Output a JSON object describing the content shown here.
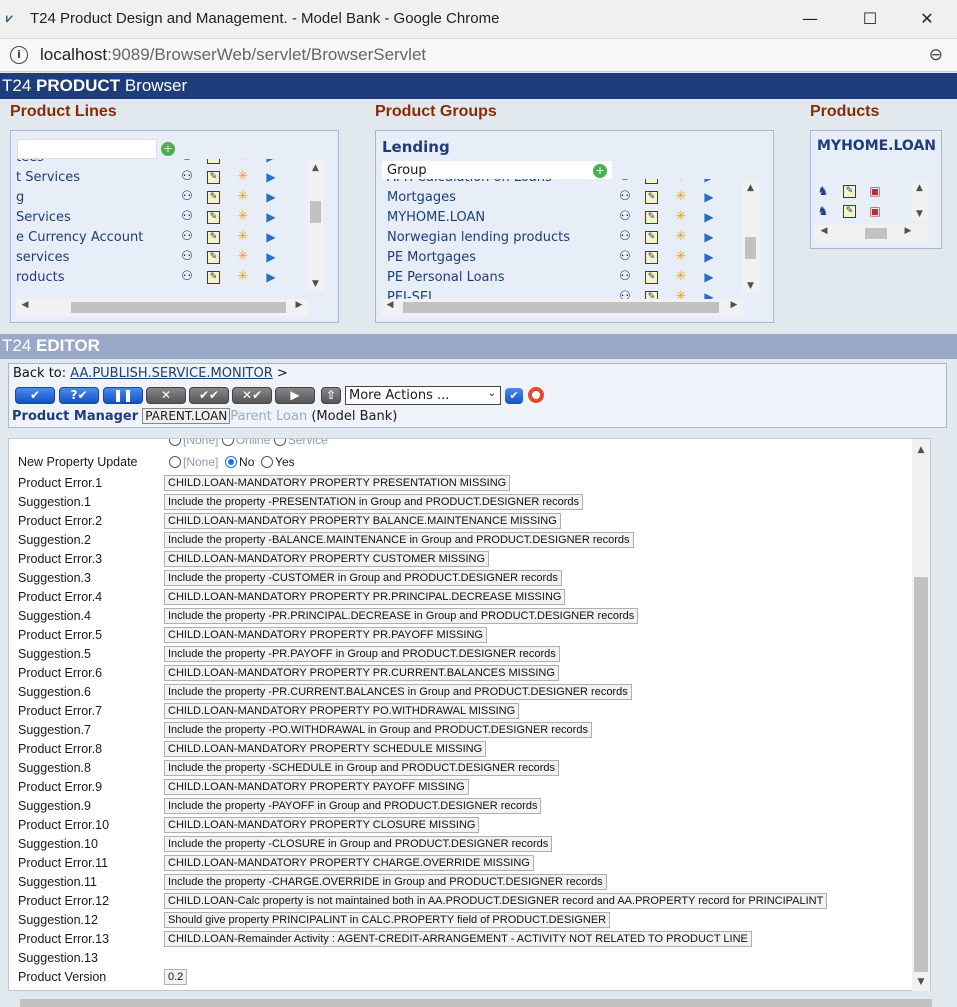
{
  "window": {
    "title": "T24 Product Design and Management. - Model Bank - Google Chrome",
    "minimize": "—",
    "maximize": "☐",
    "close": "✕"
  },
  "address": {
    "host": "localhost",
    "path": ":9089/BrowserWeb/servlet/BrowserServlet"
  },
  "browser_bar": {
    "prefix": "T24 ",
    "bold": "PRODUCT",
    "suffix": " Browser"
  },
  "product_lines": {
    "title": "Product Lines",
    "rows": [
      "tees",
      "t Services",
      "g",
      "Services",
      "e Currency Account",
      "services",
      "roducts"
    ]
  },
  "product_groups": {
    "title": "Product Groups",
    "heading": "Lending",
    "header_label": "Group",
    "rows": [
      "APR Calculation on Loans",
      "Mortgages",
      "MYHOME.LOAN",
      "Norwegian lending products",
      "PE Mortgages",
      "PE Personal Loans",
      "PEI-SEL"
    ]
  },
  "products": {
    "title": "Products",
    "heading": "MYHOME.LOAN"
  },
  "editor_bar": {
    "prefix": "T24 ",
    "bold": "EDITOR"
  },
  "editor": {
    "back_to_label": "Back to:",
    "back_to_link": "AA.PUBLISH.SERVICE.MONITOR",
    "back_to_suffix": ">",
    "more_actions": "More Actions ...",
    "product_manager": "Product Manager",
    "parent_loan": "PARENT.LOAN",
    "parent_loan_faded": "Parent Loan",
    "model_bank": "(Model Bank)"
  },
  "form": {
    "partial_row": {
      "opt1": "[None]",
      "opt2": "Online",
      "opt3": "Service"
    },
    "new_property": {
      "label": "New Property Update",
      "opt1": "[None]",
      "opt2": "No",
      "opt3": "Yes",
      "selected": "No"
    },
    "fields": [
      {
        "label": "Product Error.1",
        "value": "CHILD.LOAN-MANDATORY PROPERTY PRESENTATION MISSING"
      },
      {
        "label": "Suggestion.1",
        "value": "Include the property -PRESENTATION in Group and PRODUCT.DESIGNER records"
      },
      {
        "label": "Product Error.2",
        "value": "CHILD.LOAN-MANDATORY PROPERTY BALANCE.MAINTENANCE MISSING"
      },
      {
        "label": "Suggestion.2",
        "value": "Include the property -BALANCE.MAINTENANCE in Group and PRODUCT.DESIGNER records"
      },
      {
        "label": "Product Error.3",
        "value": "CHILD.LOAN-MANDATORY PROPERTY CUSTOMER MISSING"
      },
      {
        "label": "Suggestion.3",
        "value": "Include the property -CUSTOMER in Group and PRODUCT.DESIGNER records"
      },
      {
        "label": "Product Error.4",
        "value": "CHILD.LOAN-MANDATORY PROPERTY PR.PRINCIPAL.DECREASE MISSING"
      },
      {
        "label": "Suggestion.4",
        "value": "Include the property -PR.PRINCIPAL.DECREASE in Group and PRODUCT.DESIGNER records"
      },
      {
        "label": "Product Error.5",
        "value": "CHILD.LOAN-MANDATORY PROPERTY PR.PAYOFF MISSING"
      },
      {
        "label": "Suggestion.5",
        "value": "Include the property -PR.PAYOFF in Group and PRODUCT.DESIGNER records"
      },
      {
        "label": "Product Error.6",
        "value": "CHILD.LOAN-MANDATORY PROPERTY PR.CURRENT.BALANCES MISSING"
      },
      {
        "label": "Suggestion.6",
        "value": "Include the property -PR.CURRENT.BALANCES in Group and PRODUCT.DESIGNER records"
      },
      {
        "label": "Product Error.7",
        "value": "CHILD.LOAN-MANDATORY PROPERTY PO.WITHDRAWAL MISSING"
      },
      {
        "label": "Suggestion.7",
        "value": "Include the property -PO.WITHDRAWAL in Group and PRODUCT.DESIGNER records"
      },
      {
        "label": "Product Error.8",
        "value": "CHILD.LOAN-MANDATORY PROPERTY SCHEDULE MISSING"
      },
      {
        "label": "Suggestion.8",
        "value": "Include the property -SCHEDULE in Group and PRODUCT.DESIGNER records"
      },
      {
        "label": "Product Error.9",
        "value": "CHILD.LOAN-MANDATORY PROPERTY PAYOFF MISSING"
      },
      {
        "label": "Suggestion.9",
        "value": "Include the property -PAYOFF in Group and PRODUCT.DESIGNER records"
      },
      {
        "label": "Product Error.10",
        "value": "CHILD.LOAN-MANDATORY PROPERTY CLOSURE MISSING"
      },
      {
        "label": "Suggestion.10",
        "value": "Include the property -CLOSURE in Group and PRODUCT.DESIGNER records"
      },
      {
        "label": "Product Error.11",
        "value": "CHILD.LOAN-MANDATORY PROPERTY CHARGE.OVERRIDE MISSING"
      },
      {
        "label": "Suggestion.11",
        "value": "Include the property -CHARGE.OVERRIDE in Group and PRODUCT.DESIGNER records"
      },
      {
        "label": "Product Error.12",
        "value": "CHILD.LOAN-Calc property is not maintained both in AA.PRODUCT.DESIGNER record and AA.PROPERTY record for PRINCIPALINT"
      },
      {
        "label": "Suggestion.12",
        "value": "Should give property PRINCIPALINT in CALC.PROPERTY field of PRODUCT.DESIGNER"
      },
      {
        "label": "Product Error.13",
        "value": "CHILD.LOAN-Remainder Activity : AGENT-CREDIT-ARRANGEMENT - ACTIVITY NOT RELATED TO PRODUCT LINE"
      },
      {
        "label": "Suggestion.13",
        "value": ""
      },
      {
        "label": "Product Version",
        "value": "0.2"
      }
    ]
  },
  "colors": {
    "banner": "#1f3d7a",
    "editor_banner": "#9aa9c9",
    "section_title": "#8b2a00",
    "link": "#1f3d7a"
  }
}
